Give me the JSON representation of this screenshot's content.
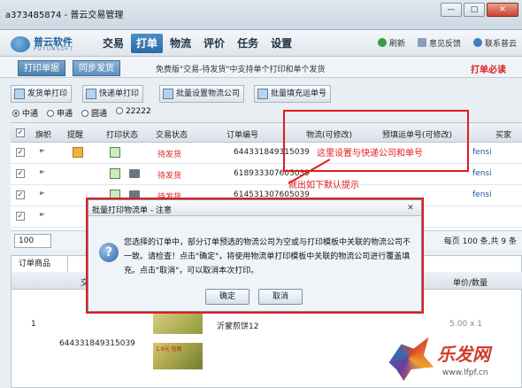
{
  "window": {
    "title": "a373485874 - 普云交易管理",
    "controls": [
      "—",
      "□",
      "✕"
    ]
  },
  "logo": {
    "name": "普云软件",
    "sub": "PUYUNSOFT"
  },
  "menu": [
    {
      "label": "交易",
      "active": false
    },
    {
      "label": "打单",
      "active": true
    },
    {
      "label": "物流",
      "active": false
    },
    {
      "label": "评价",
      "active": false
    },
    {
      "label": "任务",
      "active": false
    },
    {
      "label": "设置",
      "active": false
    }
  ],
  "nav_right": {
    "refresh": "刷新",
    "feedback": "意见反馈",
    "contact": "联系普云"
  },
  "subtabs": {
    "print_single": "打印单据",
    "sync_ship": "同步发货"
  },
  "notice": "免费版\"交易-待发货\"中支持单个打印和单个发货",
  "must_read": "打单必读",
  "toolbar": {
    "ship_print": "发货单打印",
    "express_print": "快递单打印",
    "batch_logistics": "批量设置物流公司",
    "batch_fill": "批量填充运单号"
  },
  "radios": [
    {
      "label": "中通",
      "checked": true
    },
    {
      "label": "申通",
      "checked": false
    },
    {
      "label": "圆通",
      "checked": false
    },
    {
      "label": "22222",
      "checked": false
    }
  ],
  "table": {
    "headers": {
      "flag": "旗帜",
      "remind": "提醒",
      "print_status": "打印状态",
      "trade_status": "交易状态",
      "order_no": "订单编号",
      "logistics": "物流(可修改)",
      "waybill": "预填运单号(可修改)",
      "buyer": "买家"
    },
    "rows": [
      {
        "status": "待发货",
        "order_no": "644331849315039",
        "buyer": "fensi"
      },
      {
        "status": "待发货",
        "order_no": "618933307605039",
        "buyer": "fensi"
      },
      {
        "status": "待发货",
        "order_no": "614531307605039",
        "buyer": "fensi"
      }
    ]
  },
  "annotations": {
    "modify_hint": "这里设置与快递公司和单号",
    "popup_hint": "就出如下默认提示"
  },
  "pager": {
    "page_size": "100",
    "info": "每页 100 条,共 9 条"
  },
  "lower": {
    "tab": "订单商品",
    "col_order": "交",
    "col_qty": "单价/数量",
    "row_index": "1",
    "order_no": "644331849315039",
    "thumb_label": "1.9元 包邮",
    "product_name": "沂蒙煎饼12",
    "qty": "5.00 x 1"
  },
  "dialog": {
    "title": "批量打印物流单 - 注意",
    "message": "您选择的订单中，部分订单预选的物流公司为空或与打印模板中关联的物流公司不一致。请检查！点击\"确定\"，将使用物流单打印模板中关联的物流公司进行覆盖填充。点击\"取消\"，可以取消本次打印。",
    "ok": "确定",
    "cancel": "取消"
  },
  "watermark": {
    "text": "乐发网",
    "url": "www.lfpf.cn"
  },
  "colors": {
    "accent": "#2c6aa2",
    "alert_red": "#e31b1b",
    "status_red": "#d22222"
  }
}
